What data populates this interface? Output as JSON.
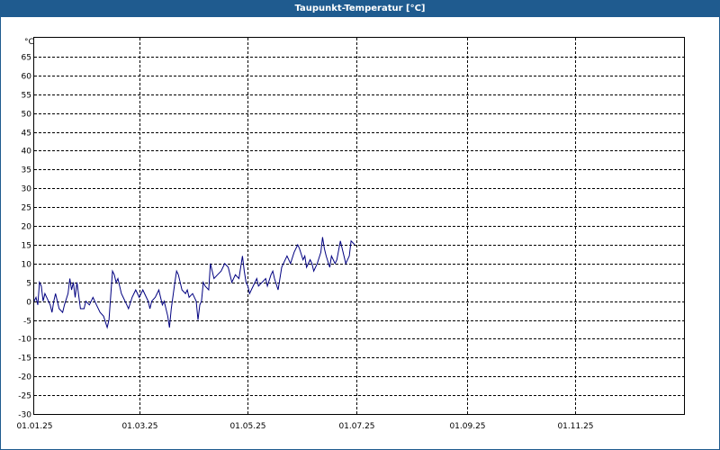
{
  "window": {
    "title": "Taupunkt-Temperatur [°C]"
  },
  "chart_data": {
    "type": "line",
    "title": "Taupunkt-Temperatur [°C]",
    "ylabel": "°C",
    "xlabel": "",
    "ylim": [
      -30,
      70
    ],
    "yticks": [
      65,
      60,
      55,
      50,
      45,
      40,
      35,
      30,
      25,
      20,
      15,
      10,
      5,
      0,
      -5,
      -10,
      -15,
      -20,
      -25,
      -30
    ],
    "xlim": [
      "2025-01-01",
      "2025-12-31"
    ],
    "xticks": [
      {
        "date": "2025-01-01",
        "label": "01.01.25"
      },
      {
        "date": "2025-03-01",
        "label": "01.03.25"
      },
      {
        "date": "2025-05-01",
        "label": "01.05.25"
      },
      {
        "date": "2025-07-01",
        "label": "01.07.25"
      },
      {
        "date": "2025-09-01",
        "label": "01.09.25"
      },
      {
        "date": "2025-11-01",
        "label": "01.11.25"
      }
    ],
    "grid": true,
    "series": [
      {
        "color": "#000080",
        "points": [
          [
            "2025-01-01",
            0
          ],
          [
            "2025-01-02",
            1
          ],
          [
            "2025-01-03",
            -1
          ],
          [
            "2025-01-04",
            5
          ],
          [
            "2025-01-05",
            4
          ],
          [
            "2025-01-06",
            0
          ],
          [
            "2025-01-07",
            2
          ],
          [
            "2025-01-09",
            0
          ],
          [
            "2025-01-10",
            -1
          ],
          [
            "2025-01-11",
            -3
          ],
          [
            "2025-01-12",
            0
          ],
          [
            "2025-01-13",
            2
          ],
          [
            "2025-01-15",
            -2
          ],
          [
            "2025-01-17",
            -3
          ],
          [
            "2025-01-18",
            -1
          ],
          [
            "2025-01-20",
            2
          ],
          [
            "2025-01-21",
            6
          ],
          [
            "2025-01-22",
            3
          ],
          [
            "2025-01-23",
            5
          ],
          [
            "2025-01-24",
            1
          ],
          [
            "2025-01-25",
            5
          ],
          [
            "2025-01-27",
            -2
          ],
          [
            "2025-01-29",
            -2
          ],
          [
            "2025-01-30",
            0
          ],
          [
            "2025-02-01",
            -1
          ],
          [
            "2025-02-03",
            1
          ],
          [
            "2025-02-05",
            -1
          ],
          [
            "2025-02-07",
            -3
          ],
          [
            "2025-02-09",
            -4
          ],
          [
            "2025-02-11",
            -7
          ],
          [
            "2025-02-12",
            -5
          ],
          [
            "2025-02-14",
            8
          ],
          [
            "2025-02-15",
            7
          ],
          [
            "2025-02-16",
            5
          ],
          [
            "2025-02-17",
            6
          ],
          [
            "2025-02-19",
            2
          ],
          [
            "2025-02-20",
            1
          ],
          [
            "2025-02-22",
            -1
          ],
          [
            "2025-02-23",
            -2
          ],
          [
            "2025-02-25",
            1
          ],
          [
            "2025-02-27",
            3
          ],
          [
            "2025-03-01",
            1
          ],
          [
            "2025-03-03",
            3
          ],
          [
            "2025-03-05",
            1
          ],
          [
            "2025-03-06",
            0
          ],
          [
            "2025-03-07",
            -2
          ],
          [
            "2025-03-08",
            0
          ],
          [
            "2025-03-10",
            1
          ],
          [
            "2025-03-12",
            3
          ],
          [
            "2025-03-13",
            1
          ],
          [
            "2025-03-14",
            -1
          ],
          [
            "2025-03-15",
            0
          ],
          [
            "2025-03-17",
            -4
          ],
          [
            "2025-03-18",
            -7
          ],
          [
            "2025-03-19",
            -2
          ],
          [
            "2025-03-21",
            5
          ],
          [
            "2025-03-22",
            8
          ],
          [
            "2025-03-23",
            7
          ],
          [
            "2025-03-25",
            3
          ],
          [
            "2025-03-27",
            2
          ],
          [
            "2025-03-28",
            3
          ],
          [
            "2025-03-29",
            1
          ],
          [
            "2025-03-31",
            2
          ],
          [
            "2025-04-02",
            0
          ],
          [
            "2025-04-03",
            -5
          ],
          [
            "2025-04-04",
            -1
          ],
          [
            "2025-04-05",
            0
          ],
          [
            "2025-04-06",
            5
          ],
          [
            "2025-04-07",
            4
          ],
          [
            "2025-04-09",
            3
          ],
          [
            "2025-04-10",
            10
          ],
          [
            "2025-04-11",
            8
          ],
          [
            "2025-04-12",
            6
          ],
          [
            "2025-04-14",
            7
          ],
          [
            "2025-04-16",
            8
          ],
          [
            "2025-04-18",
            10
          ],
          [
            "2025-04-20",
            9
          ],
          [
            "2025-04-22",
            5
          ],
          [
            "2025-04-24",
            7
          ],
          [
            "2025-04-26",
            6
          ],
          [
            "2025-04-28",
            12
          ],
          [
            "2025-04-29",
            8
          ],
          [
            "2025-04-30",
            5
          ],
          [
            "2025-05-01",
            4
          ],
          [
            "2025-05-02",
            2
          ],
          [
            "2025-05-04",
            4
          ],
          [
            "2025-05-06",
            6
          ],
          [
            "2025-05-07",
            4
          ],
          [
            "2025-05-09",
            5
          ],
          [
            "2025-05-11",
            6
          ],
          [
            "2025-05-12",
            4
          ],
          [
            "2025-05-14",
            7
          ],
          [
            "2025-05-15",
            8
          ],
          [
            "2025-05-16",
            6
          ],
          [
            "2025-05-18",
            3
          ],
          [
            "2025-05-20",
            9
          ],
          [
            "2025-05-21",
            10
          ],
          [
            "2025-05-23",
            12
          ],
          [
            "2025-05-25",
            10
          ],
          [
            "2025-05-27",
            13
          ],
          [
            "2025-05-29",
            15
          ],
          [
            "2025-05-30",
            14
          ],
          [
            "2025-06-01",
            11
          ],
          [
            "2025-06-02",
            12
          ],
          [
            "2025-06-03",
            9
          ],
          [
            "2025-06-05",
            11
          ],
          [
            "2025-06-06",
            10
          ],
          [
            "2025-06-07",
            8
          ],
          [
            "2025-06-09",
            10
          ],
          [
            "2025-06-11",
            13
          ],
          [
            "2025-06-12",
            17
          ],
          [
            "2025-06-13",
            14
          ],
          [
            "2025-06-14",
            12
          ],
          [
            "2025-06-16",
            9
          ],
          [
            "2025-06-17",
            12
          ],
          [
            "2025-06-19",
            10
          ],
          [
            "2025-06-20",
            11
          ],
          [
            "2025-06-22",
            16
          ],
          [
            "2025-06-23",
            14
          ],
          [
            "2025-06-25",
            10
          ],
          [
            "2025-06-27",
            12
          ],
          [
            "2025-06-28",
            16
          ],
          [
            "2025-06-30",
            15
          ]
        ]
      }
    ]
  }
}
